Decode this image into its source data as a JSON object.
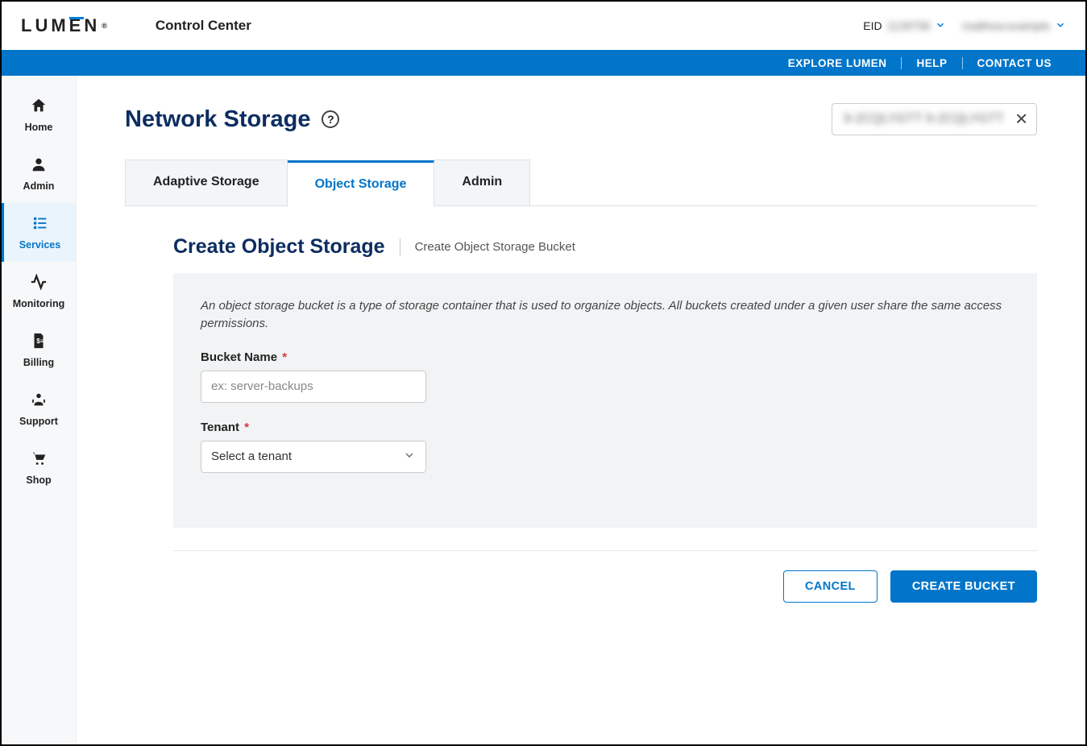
{
  "header": {
    "logo_text": "LUMEN",
    "app_title": "Control Center",
    "eid_label": "EID",
    "eid_value": "1128758",
    "user_name": "matthew.example"
  },
  "bluebar": {
    "explore": "EXPLORE LUMEN",
    "help": "HELP",
    "contact": "CONTACT US"
  },
  "sidebar": {
    "items": [
      {
        "label": "Home"
      },
      {
        "label": "Admin"
      },
      {
        "label": "Services"
      },
      {
        "label": "Monitoring"
      },
      {
        "label": "Billing"
      },
      {
        "label": "Support"
      },
      {
        "label": "Shop"
      }
    ],
    "active_index": 2
  },
  "page": {
    "title": "Network Storage",
    "context_value": "9-2CQLYGTT 9-2CQLYGTT"
  },
  "tabs": {
    "items": [
      {
        "label": "Adaptive Storage"
      },
      {
        "label": "Object Storage"
      },
      {
        "label": "Admin"
      }
    ],
    "active_index": 1
  },
  "section": {
    "heading": "Create Object Storage",
    "subtitle": "Create Object Storage Bucket"
  },
  "form": {
    "description": "An object storage bucket is a type of storage container that is used to organize objects. All buckets created under a given user share the same access permissions.",
    "bucket_name_label": "Bucket Name",
    "bucket_name_placeholder": "ex: server-backups",
    "bucket_name_value": "",
    "tenant_label": "Tenant",
    "tenant_placeholder": "Select a tenant",
    "tenant_value": ""
  },
  "actions": {
    "cancel": "CANCEL",
    "create": "CREATE BUCKET"
  }
}
